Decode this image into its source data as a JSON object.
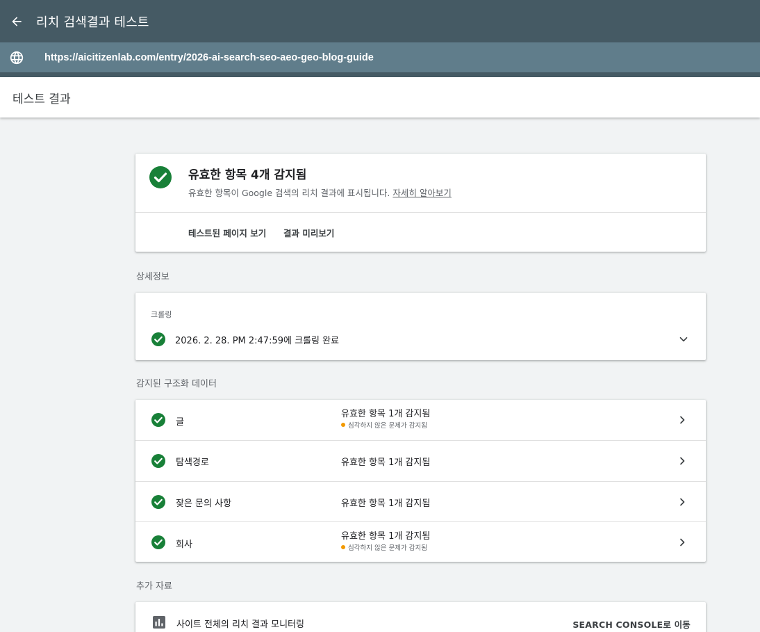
{
  "header": {
    "title": "리치 검색결과 테스트",
    "back_icon": "arrow-back-icon"
  },
  "urlbar": {
    "url": "https://aicitizenlab.com/entry/2026-ai-search-seo-aeo-geo-blog-guide",
    "icon": "globe-icon"
  },
  "subheader": {
    "title": "테스트 결과"
  },
  "summary": {
    "title": "유효한 항목 4개 감지됨",
    "description": "유효한 항목이 Google 검색의 리치 결과에 표시됩니다.",
    "learn_more": "자세히 알아보기",
    "view_page_label": "테스트된 페이지 보기",
    "preview_label": "결과 미리보기"
  },
  "sections": {
    "details": "상세정보",
    "detected": "감지된 구조화 데이터",
    "more": "추가 자료"
  },
  "crawl": {
    "label": "크롤링",
    "status": "2026. 2. 28. PM 2:47:59에 크롤링 완료"
  },
  "structured_data": [
    {
      "name": "글",
      "status": "유효한 항목 1개 감지됨",
      "warning": "심각하지 않은 문제가 감지됨"
    },
    {
      "name": "탐색경로",
      "status": "유효한 항목 1개 감지됨",
      "warning": ""
    },
    {
      "name": "잦은 문의 사항",
      "status": "유효한 항목 1개 감지됨",
      "warning": ""
    },
    {
      "name": "회사",
      "status": "유효한 항목 1개 감지됨",
      "warning": "심각하지 않은 문제가 감지됨"
    }
  ],
  "more": {
    "title": "사이트 전체의 리치 결과 모니터링",
    "link": "SEARCH CONSOLE로 이동"
  },
  "colors": {
    "header_bg": "#455a64",
    "urlbar_bg": "#607d8b",
    "success": "#188038",
    "warning": "#f29900",
    "page_bg": "#f1f3f4"
  }
}
